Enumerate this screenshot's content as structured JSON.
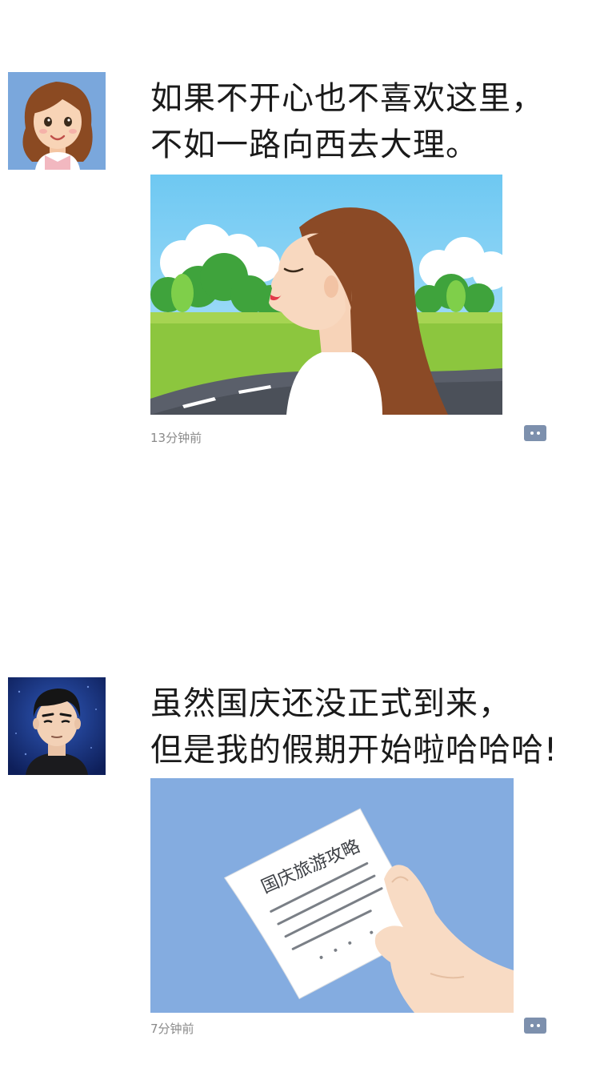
{
  "posts": [
    {
      "text_lines": [
        "如果不开心也不喜欢这里，",
        "不如一路向西去大理。"
      ],
      "timestamp": "13分钟前",
      "avatar": "girl-avatar",
      "image": "woman-on-road-illustration"
    },
    {
      "text_lines": [
        "虽然国庆还没正式到来，",
        "但是我的假期开始啦哈哈哈!"
      ],
      "timestamp": "7分钟前",
      "avatar": "boy-avatar",
      "image": "travel-guide-paper-illustration",
      "image_text": "国庆旅游攻略"
    }
  ],
  "icons": {
    "comment": "comment-icon"
  },
  "colors": {
    "background": "#ffffff",
    "text": "#1a1a1a",
    "timestamp": "#8a8a8a",
    "comment_button": "#7d90ad",
    "sky": "#7ec8f0",
    "grass": "#8cc63e",
    "paper_bg": "#84ace0"
  }
}
